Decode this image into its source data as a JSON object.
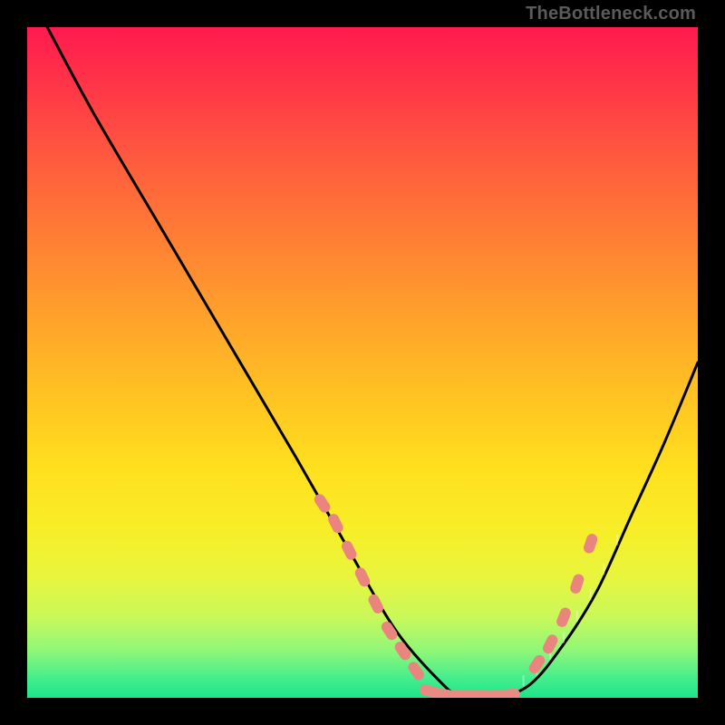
{
  "watermark": "TheBottleneck.com",
  "chart_data": {
    "type": "line",
    "title": "",
    "xlabel": "",
    "ylabel": "",
    "xlim": [
      0,
      100
    ],
    "ylim": [
      0,
      100
    ],
    "grid": false,
    "legend": false,
    "series": [
      {
        "name": "curve",
        "x": [
          3,
          10,
          20,
          30,
          40,
          48,
          55,
          62,
          65,
          70,
          75,
          80,
          85,
          90,
          95,
          100
        ],
        "y": [
          100,
          87,
          70,
          53,
          36,
          22,
          10,
          2,
          0,
          0,
          2,
          8,
          16,
          27,
          38,
          50
        ],
        "color": "#000000"
      }
    ],
    "highlight_segments": [
      {
        "name": "left-dots",
        "x": [
          44,
          46,
          48,
          50,
          52,
          54,
          56,
          58
        ],
        "y": [
          29,
          26,
          22,
          18,
          14,
          10,
          7,
          4
        ],
        "color": "#e9857e"
      },
      {
        "name": "valley-dots",
        "x": [
          60,
          62,
          64,
          66,
          68,
          70,
          72
        ],
        "y": [
          1,
          0.5,
          0.3,
          0.3,
          0.3,
          0.3,
          0.5
        ],
        "color": "#e98a83"
      },
      {
        "name": "right-dots",
        "x": [
          76,
          78,
          80,
          82,
          84
        ],
        "y": [
          5,
          8,
          12,
          17,
          23
        ],
        "color": "#e9857e"
      }
    ]
  }
}
